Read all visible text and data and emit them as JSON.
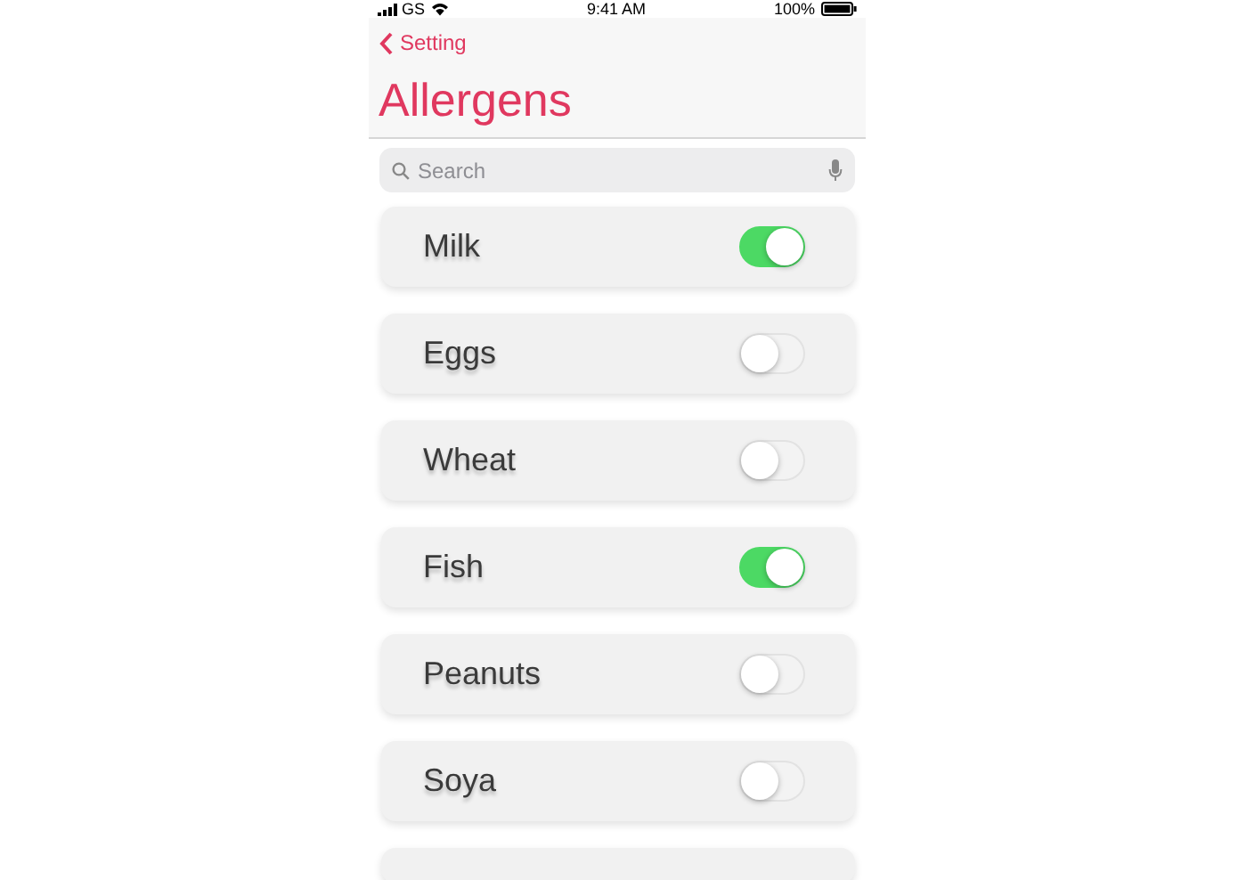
{
  "status_bar": {
    "carrier": "GS",
    "time": "9:41 AM",
    "battery": "100%"
  },
  "nav": {
    "back": "Setting",
    "title": "Allergens"
  },
  "search": {
    "placeholder": "Search"
  },
  "allergens": [
    {
      "name": "Milk",
      "on": true
    },
    {
      "name": "Eggs",
      "on": false
    },
    {
      "name": "Wheat",
      "on": false
    },
    {
      "name": "Fish",
      "on": true
    },
    {
      "name": "Peanuts",
      "on": false
    },
    {
      "name": "Soya",
      "on": false
    }
  ]
}
